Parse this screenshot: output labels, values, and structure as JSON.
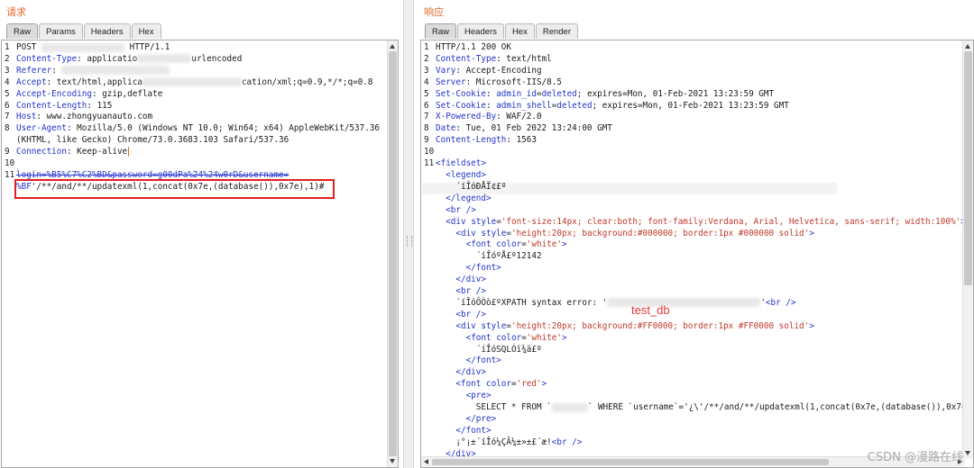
{
  "request": {
    "title": "请求",
    "tabs": [
      "Raw",
      "Params",
      "Headers",
      "Hex"
    ],
    "active_tab": "Raw"
  },
  "response": {
    "title": "响应",
    "tabs": [
      "Raw",
      "Headers",
      "Hex",
      "Render"
    ],
    "active_tab": "Raw",
    "test_db_label": "test_db"
  },
  "watermark": "CSDN @漫路在线"
}
